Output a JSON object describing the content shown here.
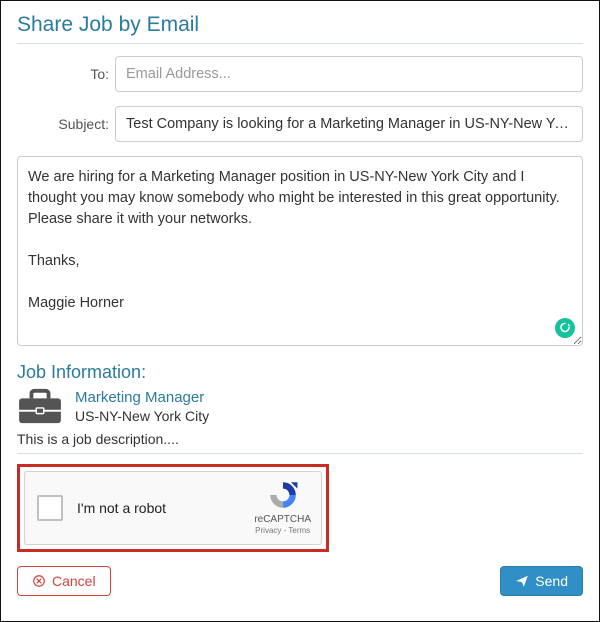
{
  "header": {
    "title": "Share Job by Email"
  },
  "form": {
    "to_label": "To:",
    "to_placeholder": "Email Address...",
    "to_value": "",
    "subject_label": "Subject:",
    "subject_value": "Test Company is looking for a Marketing Manager in US-NY-New York City",
    "message_value": "We are hiring for a Marketing Manager position in US-NY-New York City and I thought you may know somebody who might be interested in this great opportunity. Please share it with your networks.\n\nThanks,\n\nMaggie Horner"
  },
  "job_info": {
    "heading": "Job Information:",
    "title": "Marketing Manager",
    "location": "US-NY-New York City",
    "description": "This is a job description...."
  },
  "recaptcha": {
    "label": "I'm not a robot",
    "brand": "reCAPTCHA",
    "links": "Privacy - Terms"
  },
  "actions": {
    "cancel": "Cancel",
    "send": "Send"
  }
}
